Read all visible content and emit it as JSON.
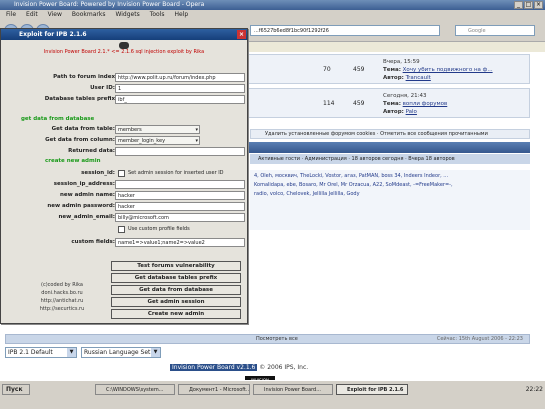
{
  "browser": {
    "title": "Invision Power Board: Powered by Invision Power Board - Opera",
    "menu": [
      "File",
      "Edit",
      "View",
      "Bookmarks",
      "Widgets",
      "Tools",
      "Help"
    ],
    "url": "...f6527b6ed8f1bc90f1292f26",
    "search_placeholder": "Google"
  },
  "forum": {
    "rows": [
      {
        "topics": "70",
        "posts": "459",
        "last_date": "Вчера, 15:59",
        "last_topic_label": "Тема:",
        "last_topic": "Хочу убить подвижного на ф...",
        "last_author_label": "Автор:",
        "last_author": "Trancault"
      },
      {
        "topics": "114",
        "posts": "459",
        "last_date": "Сегодня, 21:43",
        "last_topic_label": "Тема:",
        "last_topic": "вопли форумов",
        "last_author_label": "Автор:",
        "last_author": "Palo"
      }
    ],
    "actions": "Удалить установленные форумом cookies · Отметить все сообщения прочитанными",
    "stats_sub": "Активные гости · Администрация · 18 авторов сегодня · Вчера 18 авторов",
    "users": "4, Oleh, москвич, TheLocki, Vostor, агаз, PatMAN, boss 34, Indeers Indeor, ...",
    "users2": "Komalidapa, ebe, Bosaro, Mr Orel, Mr Orzacua, A22, SoMdeast, -=FreeMaker=-,",
    "users3": "radio, volco, Chelovek, Jellilla Jellilla, Gody",
    "bottom_left": "Посмотреть все",
    "bottom_right": "Сейчас: 15th August 2006 - 22:23",
    "skin_select": "IPB 2.1 Default",
    "lang_select": "Russian Language Set",
    "copyright_powered": "Invision Power Board v2.1.6",
    "copyright_rest": "© 2006  IPS, Inc.",
    "footer_logo": "INVISION"
  },
  "exploit": {
    "title": "Exploit for IPB 2.1.6",
    "header_line": "Invision Power Board 2.1.* <= 2.1.6 sql injection exploit by Rika",
    "fields": {
      "path_label": "Path to forum index",
      "path_value": "http://www.polit.up.ru/forum/index.php",
      "userid_label": "User ID:",
      "userid_value": "1",
      "prefix_label": "Database tables prefix",
      "prefix_value": "ibf_",
      "section_get": "get data from database",
      "table_label": "Get data from table:",
      "table_value": "members",
      "column_label": "Get data from column:",
      "column_value": "member_login_key",
      "returned_label": "Returned data:",
      "section_admin": "create new admin",
      "session_label": "session_id:",
      "session_chk": "Set admin session for inserted user ID",
      "ip_label": "session_ip_address:",
      "admin_name_label": "new admin name:",
      "admin_name_value": "hacker",
      "admin_pass_label": "new admin password:",
      "admin_pass_value": "hacker",
      "admin_email_label": "new_admin_email:",
      "admin_email_value": "billy@microsoft.com",
      "custom_chk": "Use custom profile fields",
      "custom_label": "custom fields:",
      "custom_value": "name1=>value1;name2=>value2"
    },
    "buttons": {
      "test": "Test forums vulnerability",
      "prefix": "Get database tables prefix",
      "getdata": "Get data from database",
      "session": "Get admin session",
      "create": "Create new admin"
    },
    "credits": [
      "(c)coded by Rika",
      "doni.hacks.bo.ru",
      "http://antichat.ru",
      "http://securtics.ru"
    ]
  },
  "taskbar": {
    "start": "Пуск",
    "tasks": [
      "C:\\WINDOWS\\system...",
      "Документ1 - Microsoft...",
      "Invision Power Board...",
      "Exploit for IPB 2.1.6"
    ],
    "clock": "22:22"
  }
}
